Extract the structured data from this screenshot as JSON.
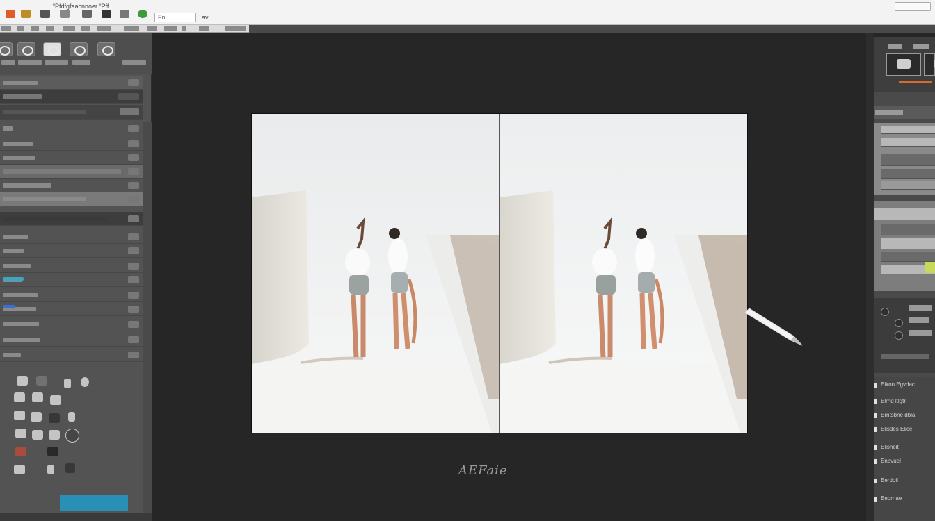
{
  "titlebar": {
    "icons": [
      "app-icon",
      "open-icon",
      "save-icon",
      "print-icon",
      "history-icon",
      "brush-icon",
      "camera-icon",
      "help-icon",
      "globe-icon"
    ],
    "menu_text": "“Pfdfgfaacnnoer  “Pff",
    "field_text": "Fn",
    "field2_text": "av"
  },
  "colors": {
    "canvas_bg": "#262626",
    "panel_bg": "#535353",
    "accent_blue": "#2a8fb5",
    "accent_lime": "#c8d85a",
    "accent_orange": "#d86a2a"
  },
  "canvas": {
    "caption": "AEFaie"
  },
  "right_panel": {
    "labels": [
      "Eikon  Egvdac",
      "Elrnd ltlgtr",
      "Erntsbne dbla",
      "Elisdes  Elice",
      "Elisheit",
      "Enbvuel",
      "Eerdoil",
      "Eeprnae"
    ]
  }
}
